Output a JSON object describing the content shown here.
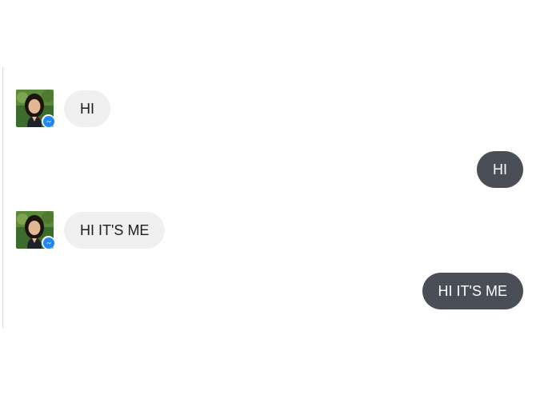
{
  "colors": {
    "incoming_bubble": "#f1f0f0",
    "outgoing_bubble": "#4a4f57",
    "incoming_text": "#1d1d1d",
    "outgoing_text": "#ffffff",
    "messenger_badge": "#1e88f7"
  },
  "messages": [
    {
      "direction": "incoming",
      "text": "HI",
      "avatar": "user-photo",
      "badge_icon": "messenger-icon"
    },
    {
      "direction": "outgoing",
      "text": "HI"
    },
    {
      "direction": "incoming",
      "text": "HI IT'S ME",
      "avatar": "user-photo",
      "badge_icon": "messenger-icon"
    },
    {
      "direction": "outgoing",
      "text": "HI IT'S ME"
    }
  ]
}
